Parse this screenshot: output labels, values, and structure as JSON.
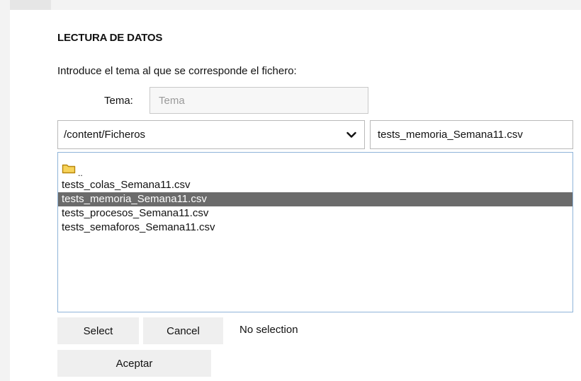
{
  "section": {
    "title": "LECTURA DE DATOS",
    "intro": "Introduce el tema al que se corresponde el fichero:"
  },
  "tema": {
    "label": "Tema:",
    "placeholder": "Tema",
    "value": ""
  },
  "chooser": {
    "path": "/content/Ficheros",
    "filename": "tests_memoria_Semana11.csv",
    "parent_entry": "..",
    "files": [
      "tests_colas_Semana11.csv",
      "tests_memoria_Semana11.csv",
      "tests_procesos_Semana11.csv",
      "tests_semaforos_Semana11.csv"
    ],
    "selected_file": "tests_memoria_Semana11.csv",
    "select_label": "Select",
    "cancel_label": "Cancel",
    "status": "No selection"
  },
  "accept_label": "Aceptar",
  "colors": {
    "selected_row": "#6b6b6b",
    "folder_icon": "#f2c037",
    "list_border": "#8fb4d9"
  },
  "icons": {
    "parent_folder": "folder-icon",
    "dropdown": "chevron-down-icon"
  }
}
